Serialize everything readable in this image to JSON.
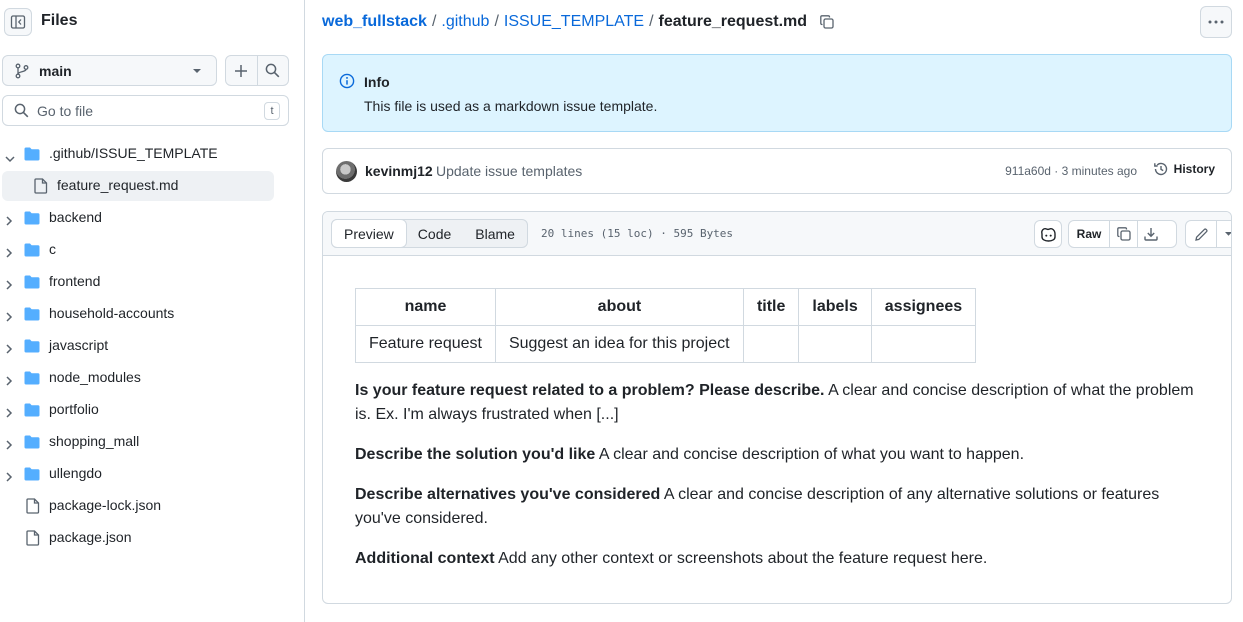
{
  "sidebar": {
    "title": "Files",
    "branch": "main",
    "goto_placeholder": "Go to file",
    "goto_shortcut": "t",
    "tree": [
      {
        "label": ".github/ISSUE_TEMPLATE",
        "type": "folder",
        "expanded": true
      },
      {
        "label": "feature_request.md",
        "type": "file",
        "selected": true
      },
      {
        "label": "backend",
        "type": "folder"
      },
      {
        "label": "c",
        "type": "folder"
      },
      {
        "label": "frontend",
        "type": "folder"
      },
      {
        "label": "household-accounts",
        "type": "folder"
      },
      {
        "label": "javascript",
        "type": "folder"
      },
      {
        "label": "node_modules",
        "type": "folder"
      },
      {
        "label": "portfolio",
        "type": "folder"
      },
      {
        "label": "shopping_mall",
        "type": "folder"
      },
      {
        "label": "ullengdo",
        "type": "folder"
      },
      {
        "label": "package-lock.json",
        "type": "file"
      },
      {
        "label": "package.json",
        "type": "file"
      }
    ]
  },
  "breadcrumb": {
    "repo": "web_fullstack",
    "sep": "/",
    "dir1": ".github",
    "dir2": "ISSUE_TEMPLATE",
    "file": "feature_request.md"
  },
  "info": {
    "title": "Info",
    "body": "This file is used as a markdown issue template."
  },
  "commit": {
    "author": "kevinmj12",
    "message": "Update issue templates",
    "meta": "911a60d · 3 minutes ago",
    "history_label": "History"
  },
  "file_header": {
    "tabs": [
      "Preview",
      "Code",
      "Blame"
    ],
    "active_tab": "Preview",
    "stats": "20 lines (15 loc) · 595 Bytes",
    "raw_label": "Raw"
  },
  "content": {
    "table_headers": [
      "name",
      "about",
      "title",
      "labels",
      "assignees"
    ],
    "table_row": [
      "Feature request",
      "Suggest an idea for this project",
      "",
      "",
      ""
    ],
    "p1_bold": "Is your feature request related to a problem? Please describe.",
    "p1_text": " A clear and concise description of what the problem is. Ex. I'm always frustrated when [...]",
    "p2_bold": "Describe the solution you'd like",
    "p2_text": " A clear and concise description of what you want to happen.",
    "p3_bold": "Describe alternatives you've considered",
    "p3_text": " A clear and concise description of any alternative solutions or features you've considered.",
    "p4_bold": "Additional context",
    "p4_text": " Add any other context or screenshots about the feature request here."
  },
  "colors": {
    "link": "#0969da",
    "folder": "#54aeff",
    "info_bg": "#ddf4ff",
    "border": "#d1d9e0"
  }
}
